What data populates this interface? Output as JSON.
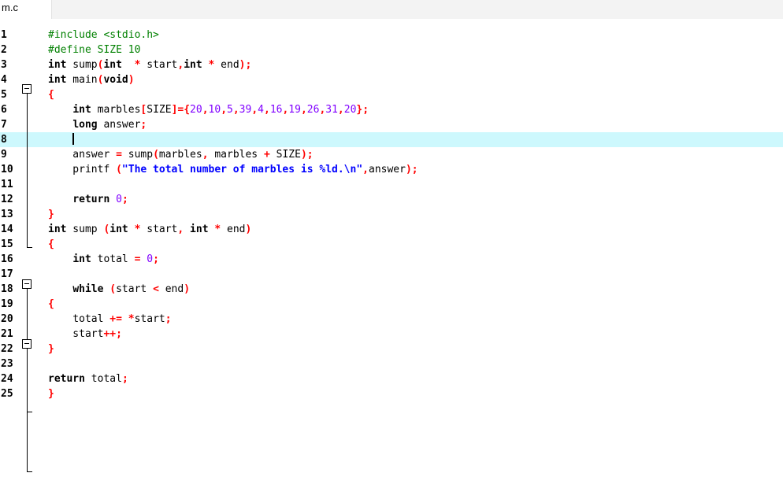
{
  "tab": {
    "label": "m.c"
  },
  "editor": {
    "line_numbers": [
      "1",
      "2",
      "3",
      "4",
      "5",
      "6",
      "7",
      "8",
      "9",
      "10",
      "11",
      "12",
      "13",
      "14",
      "15",
      "16",
      "17",
      "18",
      "19",
      "20",
      "21",
      "22",
      "23",
      "24",
      "25"
    ],
    "lines": [
      [
        {
          "t": "#include <stdio.h>",
          "c": "pp"
        }
      ],
      [
        {
          "t": "#define SIZE 10",
          "c": "pp"
        }
      ],
      [
        {
          "t": "int",
          "c": "kw"
        },
        {
          "t": " sump",
          "c": ""
        },
        {
          "t": "(",
          "c": "pn"
        },
        {
          "t": "int",
          "c": "kw"
        },
        {
          "t": "  ",
          "c": ""
        },
        {
          "t": "*",
          "c": "pn"
        },
        {
          "t": " start",
          "c": ""
        },
        {
          "t": ",",
          "c": "pn"
        },
        {
          "t": "int",
          "c": "kw"
        },
        {
          "t": " ",
          "c": ""
        },
        {
          "t": "*",
          "c": "pn"
        },
        {
          "t": " end",
          "c": ""
        },
        {
          "t": ");",
          "c": "pn"
        }
      ],
      [
        {
          "t": "int",
          "c": "kw"
        },
        {
          "t": " main",
          "c": ""
        },
        {
          "t": "(",
          "c": "pn"
        },
        {
          "t": "void",
          "c": "kw"
        },
        {
          "t": ")",
          "c": "pn"
        }
      ],
      [
        {
          "t": "{",
          "c": "pn"
        }
      ],
      [
        {
          "t": "    ",
          "c": ""
        },
        {
          "t": "int",
          "c": "kw"
        },
        {
          "t": " marbles",
          "c": ""
        },
        {
          "t": "[",
          "c": "pn"
        },
        {
          "t": "SIZE",
          "c": ""
        },
        {
          "t": "]={",
          "c": "pn"
        },
        {
          "t": "20",
          "c": "num"
        },
        {
          "t": ",",
          "c": "pn"
        },
        {
          "t": "10",
          "c": "num"
        },
        {
          "t": ",",
          "c": "pn"
        },
        {
          "t": "5",
          "c": "num"
        },
        {
          "t": ",",
          "c": "pn"
        },
        {
          "t": "39",
          "c": "num"
        },
        {
          "t": ",",
          "c": "pn"
        },
        {
          "t": "4",
          "c": "num"
        },
        {
          "t": ",",
          "c": "pn"
        },
        {
          "t": "16",
          "c": "num"
        },
        {
          "t": ",",
          "c": "pn"
        },
        {
          "t": "19",
          "c": "num"
        },
        {
          "t": ",",
          "c": "pn"
        },
        {
          "t": "26",
          "c": "num"
        },
        {
          "t": ",",
          "c": "pn"
        },
        {
          "t": "31",
          "c": "num"
        },
        {
          "t": ",",
          "c": "pn"
        },
        {
          "t": "20",
          "c": "num"
        },
        {
          "t": "};",
          "c": "pn"
        }
      ],
      [
        {
          "t": "    ",
          "c": ""
        },
        {
          "t": "long",
          "c": "kw"
        },
        {
          "t": " answer",
          "c": ""
        },
        {
          "t": ";",
          "c": "pn"
        }
      ],
      [
        {
          "t": "    ",
          "c": ""
        }
      ],
      [
        {
          "t": "    answer ",
          "c": ""
        },
        {
          "t": "=",
          "c": "pn"
        },
        {
          "t": " sump",
          "c": ""
        },
        {
          "t": "(",
          "c": "pn"
        },
        {
          "t": "marbles",
          "c": ""
        },
        {
          "t": ",",
          "c": "pn"
        },
        {
          "t": " marbles ",
          "c": ""
        },
        {
          "t": "+",
          "c": "pn"
        },
        {
          "t": " SIZE",
          "c": ""
        },
        {
          "t": ");",
          "c": "pn"
        }
      ],
      [
        {
          "t": "    printf ",
          "c": ""
        },
        {
          "t": "(",
          "c": "pn"
        },
        {
          "t": "\"The total number of marbles is %ld.\\n\"",
          "c": "str"
        },
        {
          "t": ",",
          "c": "pn"
        },
        {
          "t": "answer",
          "c": ""
        },
        {
          "t": ");",
          "c": "pn"
        }
      ],
      [],
      [
        {
          "t": "    ",
          "c": ""
        },
        {
          "t": "return",
          "c": "kw"
        },
        {
          "t": " ",
          "c": ""
        },
        {
          "t": "0",
          "c": "num"
        },
        {
          "t": ";",
          "c": "pn"
        }
      ],
      [
        {
          "t": "}",
          "c": "pn"
        }
      ],
      [
        {
          "t": "int",
          "c": "kw"
        },
        {
          "t": " sump ",
          "c": ""
        },
        {
          "t": "(",
          "c": "pn"
        },
        {
          "t": "int",
          "c": "kw"
        },
        {
          "t": " ",
          "c": ""
        },
        {
          "t": "*",
          "c": "pn"
        },
        {
          "t": " start",
          "c": ""
        },
        {
          "t": ",",
          "c": "pn"
        },
        {
          "t": " ",
          "c": ""
        },
        {
          "t": "int",
          "c": "kw"
        },
        {
          "t": " ",
          "c": ""
        },
        {
          "t": "*",
          "c": "pn"
        },
        {
          "t": " end",
          "c": ""
        },
        {
          "t": ")",
          "c": "pn"
        }
      ],
      [
        {
          "t": "{",
          "c": "pn"
        }
      ],
      [
        {
          "t": "    ",
          "c": ""
        },
        {
          "t": "int",
          "c": "kw"
        },
        {
          "t": " total ",
          "c": ""
        },
        {
          "t": "=",
          "c": "pn"
        },
        {
          "t": " ",
          "c": ""
        },
        {
          "t": "0",
          "c": "num"
        },
        {
          "t": ";",
          "c": "pn"
        }
      ],
      [],
      [
        {
          "t": "    ",
          "c": ""
        },
        {
          "t": "while",
          "c": "kw"
        },
        {
          "t": " ",
          "c": ""
        },
        {
          "t": "(",
          "c": "pn"
        },
        {
          "t": "start ",
          "c": ""
        },
        {
          "t": "<",
          "c": "pn"
        },
        {
          "t": " end",
          "c": ""
        },
        {
          "t": ")",
          "c": "pn"
        }
      ],
      [
        {
          "t": "{",
          "c": "pn"
        }
      ],
      [
        {
          "t": "    total ",
          "c": ""
        },
        {
          "t": "+=",
          "c": "pn"
        },
        {
          "t": " ",
          "c": ""
        },
        {
          "t": "*",
          "c": "pn"
        },
        {
          "t": "start",
          "c": ""
        },
        {
          "t": ";",
          "c": "pn"
        }
      ],
      [
        {
          "t": "    start",
          "c": ""
        },
        {
          "t": "++;",
          "c": "pn"
        }
      ],
      [
        {
          "t": "}",
          "c": "pn"
        }
      ],
      [],
      [
        {
          "t": "return",
          "c": "kw"
        },
        {
          "t": " total",
          "c": ""
        },
        {
          "t": ";",
          "c": "pn"
        }
      ],
      [
        {
          "t": "}",
          "c": "pn"
        }
      ]
    ],
    "current_line": 8,
    "colors": {
      "keyword": "#000000",
      "preprocessor": "#008000",
      "punctuation": "#ff0000",
      "number": "#8000ff",
      "string": "#0000ff",
      "current_line_bg": "#cdf8fd"
    }
  }
}
